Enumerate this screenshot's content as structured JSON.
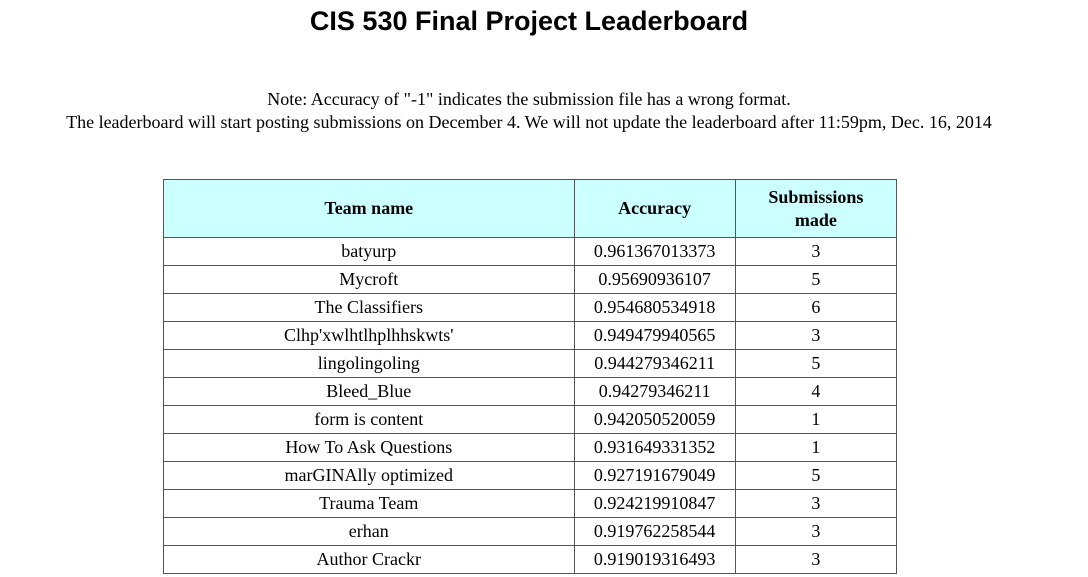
{
  "page": {
    "title": "CIS 530 Final Project Leaderboard",
    "note_line1": "Note: Accuracy of \"-1\" indicates the submission file has a wrong format.",
    "note_line2": "The leaderboard will start posting submissions on December 4. We will not update the leaderboard after 11:59pm, Dec. 16, 2014"
  },
  "table": {
    "headers": {
      "team": "Team name",
      "accuracy": "Accuracy",
      "submissions": "Submissions made"
    },
    "header_bg": "#ccffff",
    "rows": [
      {
        "team": "batyurp",
        "accuracy": "0.961367013373",
        "submissions": "3"
      },
      {
        "team": "Mycroft",
        "accuracy": "0.95690936107",
        "submissions": "5"
      },
      {
        "team": "The Classifiers",
        "accuracy": "0.954680534918",
        "submissions": "6"
      },
      {
        "team": "Clhp'xwlhtlhplhhskwts'",
        "accuracy": "0.949479940565",
        "submissions": "3"
      },
      {
        "team": "lingolingoling",
        "accuracy": "0.944279346211",
        "submissions": "5"
      },
      {
        "team": "Bleed_Blue",
        "accuracy": "0.94279346211",
        "submissions": "4"
      },
      {
        "team": "form is content",
        "accuracy": "0.942050520059",
        "submissions": "1"
      },
      {
        "team": "How To Ask Questions",
        "accuracy": "0.931649331352",
        "submissions": "1"
      },
      {
        "team": "marGINAlly optimized",
        "accuracy": "0.927191679049",
        "submissions": "5"
      },
      {
        "team": "Trauma Team",
        "accuracy": "0.924219910847",
        "submissions": "3"
      },
      {
        "team": "erhan",
        "accuracy": "0.919762258544",
        "submissions": "3"
      },
      {
        "team": "Author Crackr",
        "accuracy": "0.919019316493",
        "submissions": "3"
      }
    ]
  }
}
